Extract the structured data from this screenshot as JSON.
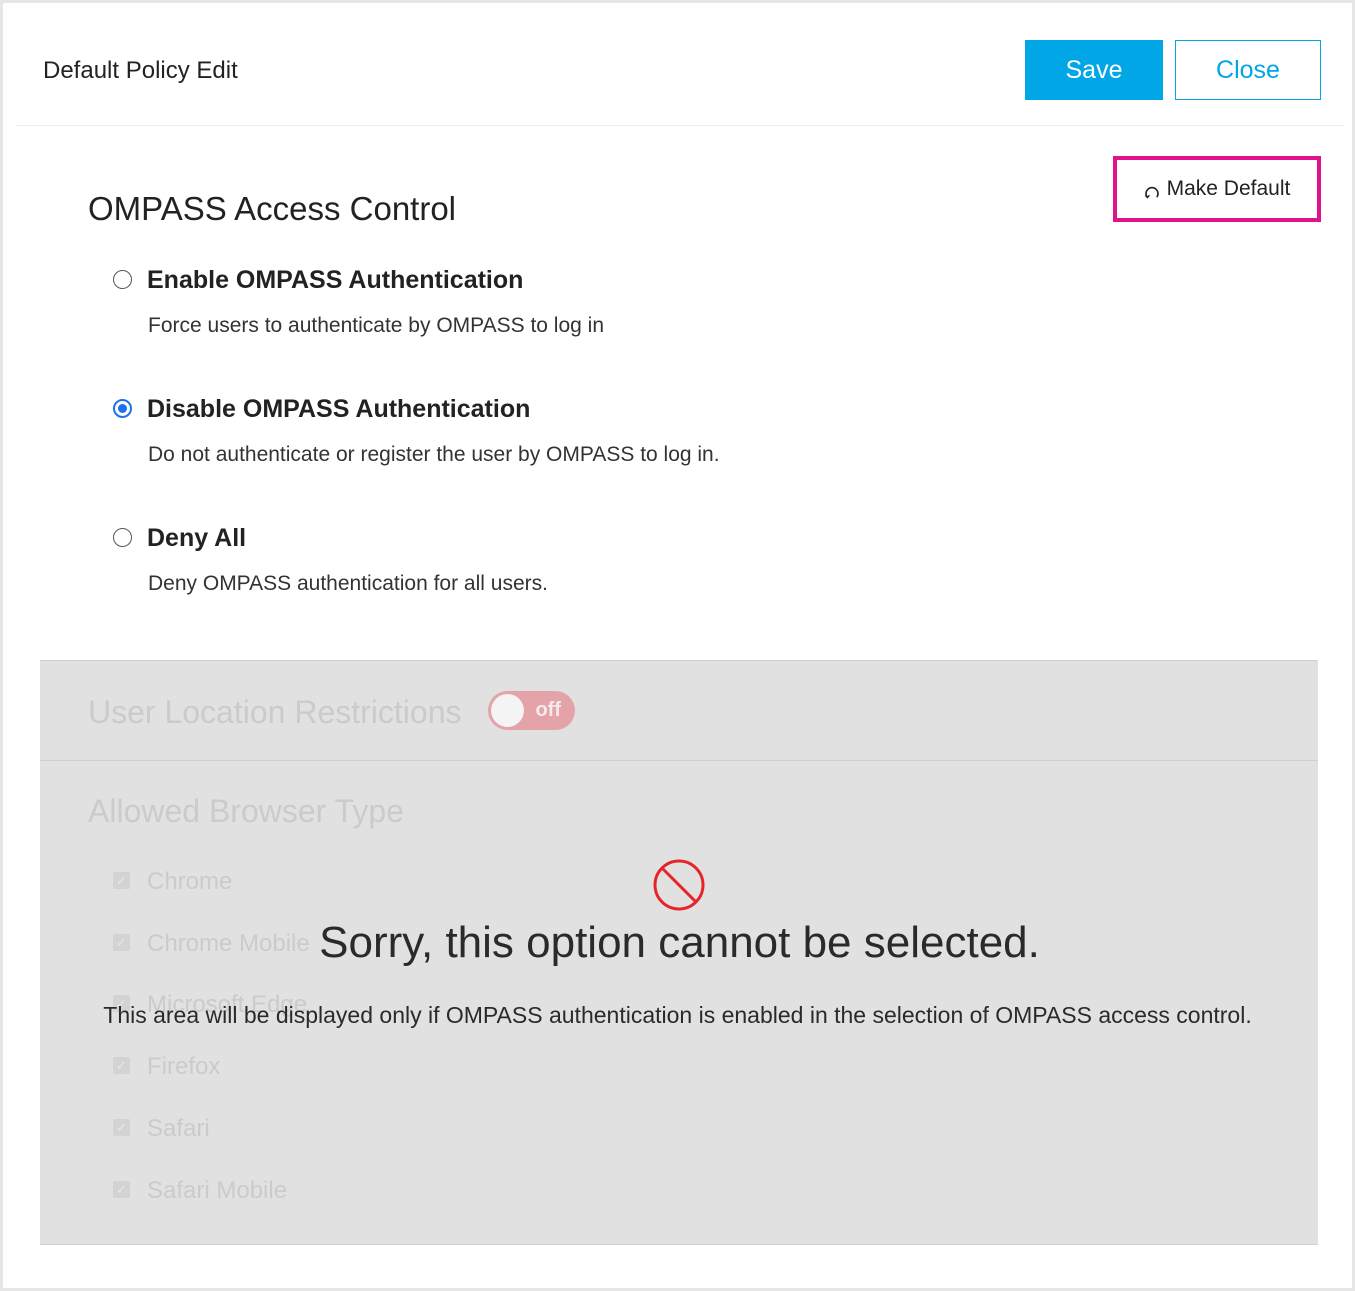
{
  "header": {
    "title": "Default Policy Edit",
    "save_label": "Save",
    "close_label": "Close"
  },
  "make_default": {
    "label": "Make Default",
    "icon": "refresh-icon"
  },
  "access_control": {
    "title": "OMPASS Access Control",
    "options": [
      {
        "label": "Enable OMPASS Authentication",
        "description": "Force users to authenticate by OMPASS to log in",
        "selected": false
      },
      {
        "label": "Disable OMPASS Authentication",
        "description": "Do not authenticate or register the user by OMPASS to log in.",
        "selected": true
      },
      {
        "label": "Deny All",
        "description": "Deny OMPASS authentication for all users.",
        "selected": false
      }
    ]
  },
  "location": {
    "title": "User Location Restrictions",
    "toggle_label": "off"
  },
  "browsers": {
    "title": "Allowed Browser Type",
    "items": [
      "Chrome",
      "Chrome Mobile",
      "Microsoft Edge",
      "Firefox",
      "Safari",
      "Safari Mobile"
    ]
  },
  "overlay": {
    "icon": "block-icon",
    "message": "Sorry, this option cannot be selected.",
    "detail": "This area will be displayed only if OMPASS authentication is enabled in the selection of OMPASS access control."
  },
  "colors": {
    "accent": "#00a6e6",
    "highlight": "#e0138c",
    "radio_selected": "#1a73e8",
    "block_red": "#e8242b"
  }
}
